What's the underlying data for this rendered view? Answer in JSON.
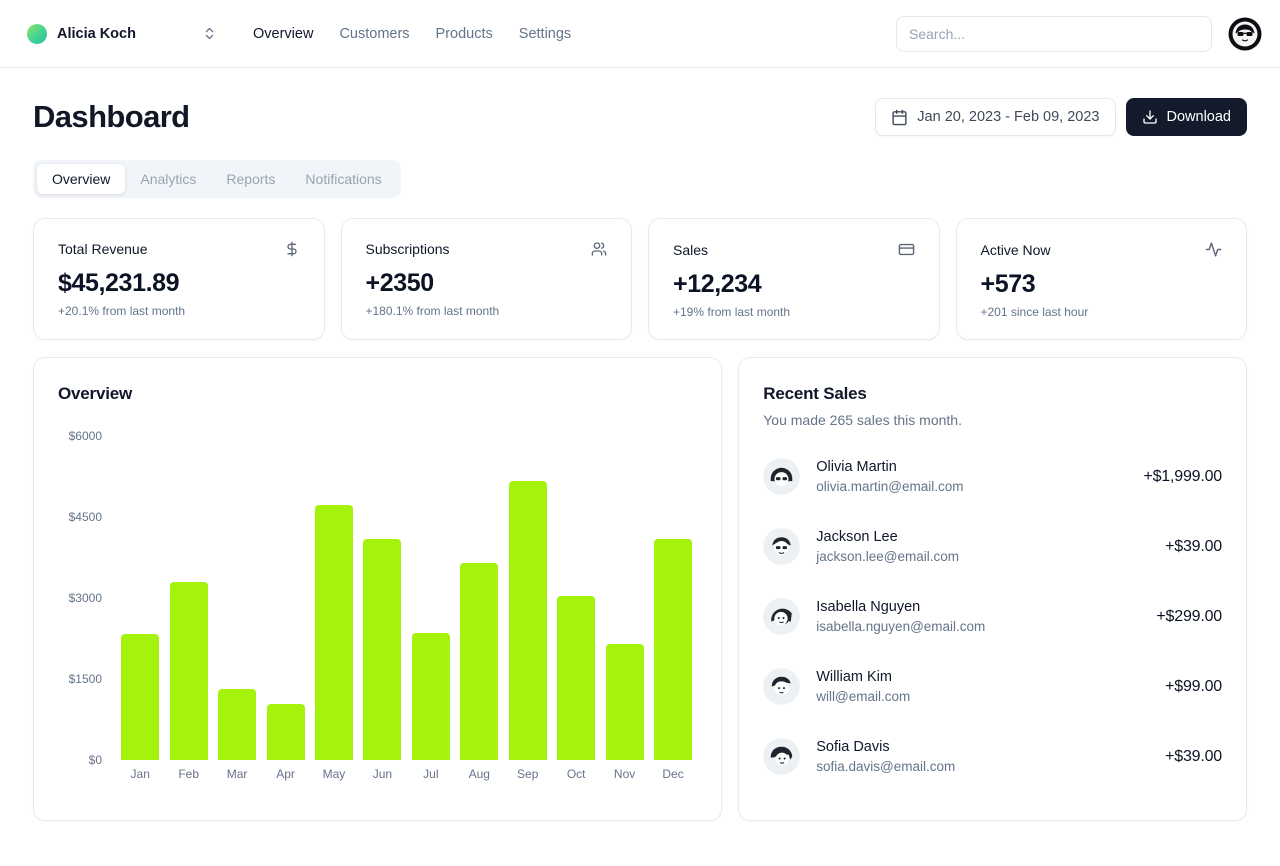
{
  "colors": {
    "bar": "#a5f20d",
    "primary_button": "#131a2b",
    "team_avatar_gradient": [
      "#8fe565",
      "#1fc3a8"
    ]
  },
  "header": {
    "team_name": "Alicia Koch",
    "nav": [
      {
        "label": "Overview",
        "active": true
      },
      {
        "label": "Customers",
        "active": false
      },
      {
        "label": "Products",
        "active": false
      },
      {
        "label": "Settings",
        "active": false
      }
    ],
    "search_placeholder": "Search..."
  },
  "page": {
    "title": "Dashboard",
    "date_range": "Jan 20, 2023 - Feb 09, 2023",
    "download_label": "Download",
    "tabs": [
      {
        "label": "Overview",
        "active": true
      },
      {
        "label": "Analytics",
        "active": false
      },
      {
        "label": "Reports",
        "active": false
      },
      {
        "label": "Notifications",
        "active": false
      }
    ]
  },
  "stats": [
    {
      "title": "Total Revenue",
      "icon": "dollar-sign",
      "value": "$45,231.89",
      "delta": "+20.1% from last month"
    },
    {
      "title": "Subscriptions",
      "icon": "users",
      "value": "+2350",
      "delta": "+180.1% from last month"
    },
    {
      "title": "Sales",
      "icon": "credit-card",
      "value": "+12,234",
      "delta": "+19% from last month"
    },
    {
      "title": "Active Now",
      "icon": "activity",
      "value": "+573",
      "delta": "+201 since last hour"
    }
  ],
  "chart_data": {
    "type": "bar",
    "title": "Overview",
    "categories": [
      "Jan",
      "Feb",
      "Mar",
      "Apr",
      "May",
      "Jun",
      "Jul",
      "Aug",
      "Sep",
      "Oct",
      "Nov",
      "Dec"
    ],
    "values": [
      2330,
      3300,
      1310,
      1040,
      4720,
      4090,
      2350,
      3650,
      5170,
      3040,
      2150,
      4090
    ],
    "y_ticks": [
      "$6000",
      "$4500",
      "$3000",
      "$1500",
      "$0"
    ],
    "ylim": [
      0,
      6000
    ],
    "xlabel": "",
    "ylabel": "",
    "grid": false,
    "legend": false,
    "bar_color": "#a5f20d"
  },
  "recent_sales": {
    "title": "Recent Sales",
    "subtitle": "You made 265 sales this month.",
    "items": [
      {
        "name": "Olivia Martin",
        "email": "olivia.martin@email.com",
        "amount": "+$1,999.00"
      },
      {
        "name": "Jackson Lee",
        "email": "jackson.lee@email.com",
        "amount": "+$39.00"
      },
      {
        "name": "Isabella Nguyen",
        "email": "isabella.nguyen@email.com",
        "amount": "+$299.00"
      },
      {
        "name": "William Kim",
        "email": "will@email.com",
        "amount": "+$99.00"
      },
      {
        "name": "Sofia Davis",
        "email": "sofia.davis@email.com",
        "amount": "+$39.00"
      }
    ]
  }
}
